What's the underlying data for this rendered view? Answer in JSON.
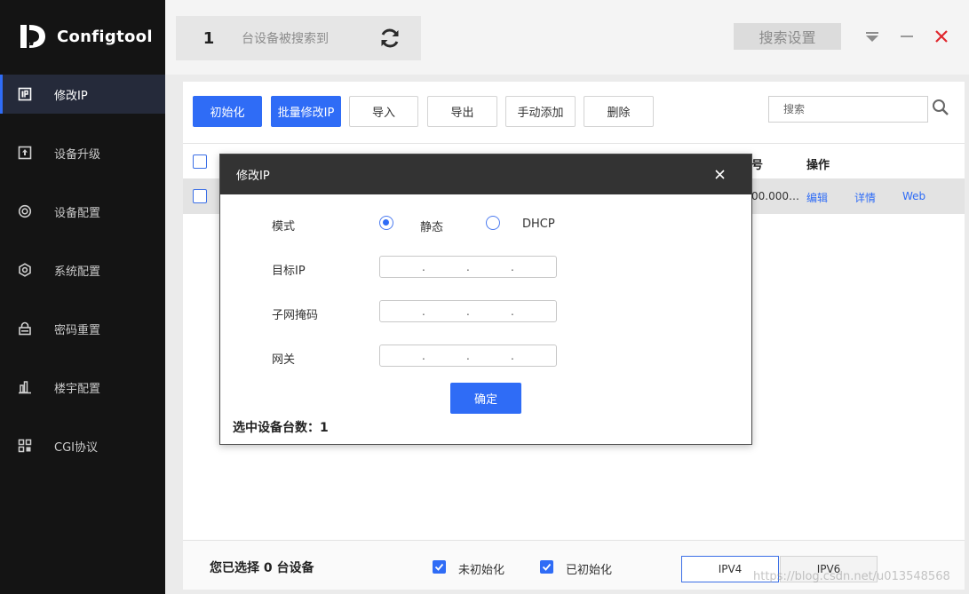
{
  "app": {
    "name": "Configtool"
  },
  "sidebar": {
    "items": [
      {
        "label": "修改IP",
        "icon": "ip-icon",
        "active": true
      },
      {
        "label": "设备升级",
        "icon": "upgrade-icon",
        "active": false
      },
      {
        "label": "设备配置",
        "icon": "device-config-icon",
        "active": false
      },
      {
        "label": "系统配置",
        "icon": "system-config-icon",
        "active": false
      },
      {
        "label": "密码重置",
        "icon": "password-reset-icon",
        "active": false
      },
      {
        "label": "楼宇配置",
        "icon": "building-config-icon",
        "active": false
      },
      {
        "label": "CGI协议",
        "icon": "cgi-icon",
        "active": false
      }
    ]
  },
  "header": {
    "device_count": "1",
    "device_found_text": "台设备被搜索到",
    "search_settings_label": "搜索设置"
  },
  "toolbar": {
    "init_label": "初始化",
    "batch_modify_label": "批量修改IP",
    "import_label": "导入",
    "export_label": "导出",
    "manual_add_label": "手动添加",
    "delete_label": "删除",
    "search_placeholder": "搜索"
  },
  "table": {
    "header_partial": "号",
    "header_actions": "操作",
    "rows": [
      {
        "cell_partial": "00.000…",
        "edit": "编辑",
        "details": "详情",
        "web": "Web"
      }
    ]
  },
  "footer": {
    "selected_summary": "您已选择 0 台设备",
    "uninitialized_label": "未初始化",
    "initialized_label": "已初始化",
    "ipv4_label": "IPV4",
    "ipv6_label": "IPV6"
  },
  "modal": {
    "title": "修改IP",
    "mode_label": "模式",
    "static_label": "静态",
    "dhcp_label": "DHCP",
    "target_ip_label": "目标IP",
    "subnet_mask_label": "子网掩码",
    "gateway_label": "网关",
    "confirm_label": "确定",
    "selected_count_text": "选中设备台数：1"
  },
  "watermark": "https://blog.csdn.net/u013548568",
  "colors": {
    "accent": "#2f6cf6",
    "sidebar_bg": "#141414",
    "close_red": "#e0262c"
  }
}
